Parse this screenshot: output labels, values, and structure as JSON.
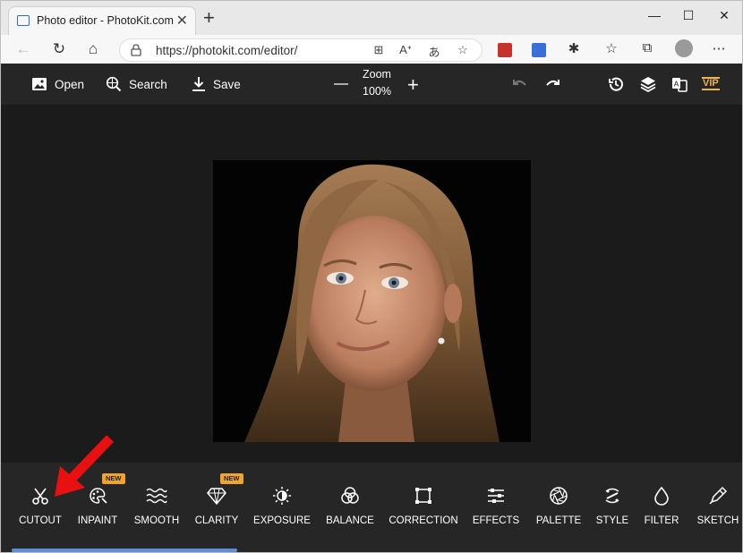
{
  "browser": {
    "tab_title": "Photo editor - PhotoKit.com",
    "tab_close": "✕",
    "new_tab": "+",
    "window_controls": {
      "minimize": "—",
      "maximize": "☐",
      "close": "✕"
    },
    "url": "https://photokit.com/editor/"
  },
  "app_header": {
    "open_label": "Open",
    "search_label": "Search",
    "save_label": "Save",
    "zoom_label": "Zoom",
    "zoom_value": "100%",
    "vip_label": "VIP"
  },
  "tools": [
    {
      "label": "CUTOUT",
      "icon": "scissors-icon",
      "badge": ""
    },
    {
      "label": "INPAINT",
      "icon": "palette-brush-icon",
      "badge": "NEW"
    },
    {
      "label": "SMOOTH",
      "icon": "waves-icon",
      "badge": ""
    },
    {
      "label": "CLARITY",
      "icon": "diamond-icon",
      "badge": "NEW"
    },
    {
      "label": "EXPOSURE",
      "icon": "sun-half-icon",
      "badge": ""
    },
    {
      "label": "BALANCE",
      "icon": "circles-icon",
      "badge": ""
    },
    {
      "label": "CORRECTION",
      "icon": "crop-frame-icon",
      "badge": ""
    },
    {
      "label": "EFFECTS",
      "icon": "sliders-icon",
      "badge": ""
    },
    {
      "label": "PALETTE",
      "icon": "aperture-icon",
      "badge": ""
    },
    {
      "label": "STYLE",
      "icon": "style-icon",
      "badge": ""
    },
    {
      "label": "FILTER",
      "icon": "drop-icon",
      "badge": ""
    },
    {
      "label": "SKETCH",
      "icon": "pen-icon",
      "badge": ""
    }
  ],
  "colors": {
    "accent_badge": "#f0a32d",
    "annotation_arrow": "#e81010",
    "scrollbar": "#5b8fd8"
  }
}
